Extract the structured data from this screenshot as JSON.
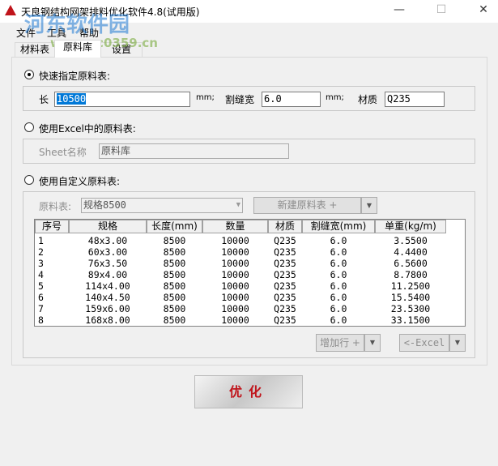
{
  "window": {
    "title": "天良钢结构网架排料优化软件4.8(试用版)",
    "minimize": "—",
    "maximize": "☐",
    "close": "✕"
  },
  "watermark": {
    "name": "河东软件园",
    "url": "www.pc0359.cn"
  },
  "menu": [
    "文件",
    "工具",
    "帮助"
  ],
  "tabs": [
    "材料表",
    "原料库",
    "设置"
  ],
  "quick": {
    "label": "快速指定原料表:",
    "length_label": "长",
    "length_value": "10500",
    "unit1": "mm;",
    "kerf_label": "割缝宽",
    "kerf_value": "6.0",
    "unit2": "mm;",
    "material_label": "材质",
    "material_value": "Q235"
  },
  "excel": {
    "label": "使用Excel中的原料表:",
    "sheet_label": "Sheet名称",
    "sheet_value": "原料库"
  },
  "custom": {
    "label": "使用自定义原料表:",
    "table_label": "原料表:",
    "table_value": "规格8500",
    "new_button": "新建原料表 +"
  },
  "table": {
    "headers": [
      "序号",
      "规格",
      "长度(mm)",
      "数量",
      "材质",
      "割缝宽(mm)",
      "单重(kg/m)"
    ],
    "rows": [
      [
        "1",
        "48x3.00",
        "8500",
        "10000",
        "Q235",
        "6.0",
        "3.5500"
      ],
      [
        "2",
        "60x3.00",
        "8500",
        "10000",
        "Q235",
        "6.0",
        "4.4400"
      ],
      [
        "3",
        "76x3.50",
        "8500",
        "10000",
        "Q235",
        "6.0",
        "6.5600"
      ],
      [
        "4",
        "89x4.00",
        "8500",
        "10000",
        "Q235",
        "6.0",
        "8.7800"
      ],
      [
        "5",
        "114x4.00",
        "8500",
        "10000",
        "Q235",
        "6.0",
        "11.2500"
      ],
      [
        "6",
        "140x4.50",
        "8500",
        "10000",
        "Q235",
        "6.0",
        "15.5400"
      ],
      [
        "7",
        "159x6.00",
        "8500",
        "10000",
        "Q235",
        "6.0",
        "23.5300"
      ],
      [
        "8",
        "168x8.00",
        "8500",
        "10000",
        "Q235",
        "6.0",
        "33.1500"
      ]
    ]
  },
  "buttons": {
    "add_row": "增加行 +",
    "from_excel": "<-Excel",
    "optimize": "优化"
  }
}
